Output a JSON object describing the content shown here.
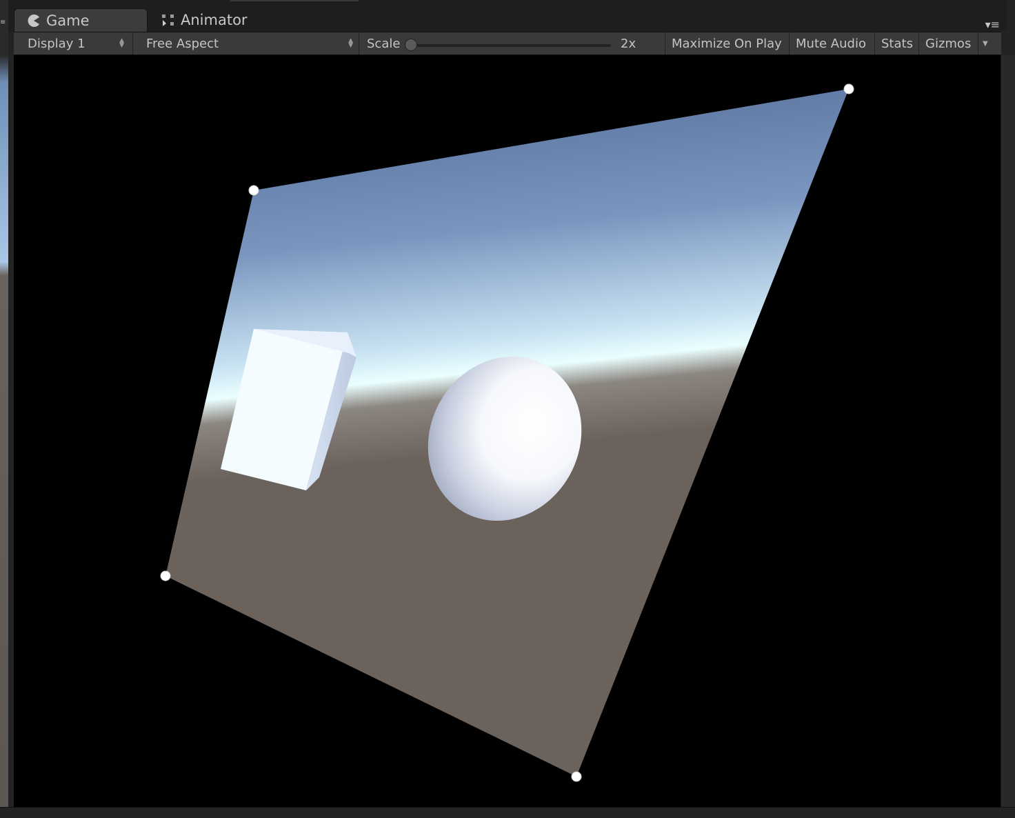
{
  "tabs": [
    {
      "label": "Game",
      "icon": "pacman-icon",
      "active": true
    },
    {
      "label": "Animator",
      "icon": "animator-grid-icon",
      "active": false
    }
  ],
  "toolbar": {
    "display": "Display 1",
    "aspect": "Free Aspect",
    "scale_label": "Scale",
    "scale_value": "2x",
    "maximize_label": "Maximize On Play",
    "mute_label": "Mute Audio",
    "stats_label": "Stats",
    "gizmos_label": "Gizmos"
  },
  "colors": {
    "panel_bg": "#3a3a3a",
    "sky_top": "#56709a",
    "horizon": "#e8fbff",
    "ground": "#6b625c",
    "handle": "#ffffff"
  }
}
